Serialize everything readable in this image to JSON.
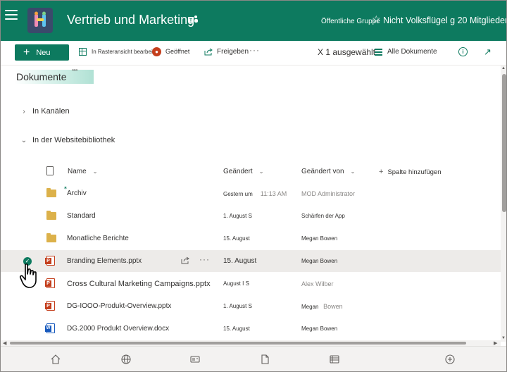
{
  "header": {
    "site_title": "Vertrieb und Marketing",
    "group_type": "Öffentliche Gruppe",
    "follow_text": "Nicht Volksflügel g 20 Mitglieder",
    "accent": "#0d7a5f"
  },
  "commandbar": {
    "new_label": "Neu",
    "grid_label": "In Rasteransicht bearbeiten",
    "open_label": "Geöffnet",
    "share_label": "Freigeben",
    "more_label": "···",
    "selected_label": "X 1 ausgewählt",
    "view_label": "Alle Dokumente",
    "info_glyph": "i",
    "expand_glyph": "↗"
  },
  "library": {
    "title": "Dokumente",
    "badge": "ooo"
  },
  "sections": {
    "channels": "In Kanälen",
    "site_library": "In der Websitebibliothek"
  },
  "columns": {
    "name": "Name",
    "modified": "Geändert",
    "modified_by": "Geändert von",
    "add_column": "Spalte hinzufügen"
  },
  "rows": [
    {
      "type": "folder",
      "name": "Archiv",
      "modified": "Gestern um",
      "modified_extra": "11:13 AM",
      "modified_by": "MOD Administrator",
      "by_faded": true
    },
    {
      "type": "folder",
      "name": "Standard",
      "modified": "1. August S",
      "modified_extra": "",
      "modified_by": "Schärfen der App",
      "by_faded": false
    },
    {
      "type": "folder",
      "name": "Monatliche Berichte",
      "modified": "15. August",
      "modified_extra": "",
      "modified_by": "Megan Bowen",
      "by_faded": false
    },
    {
      "type": "pptx",
      "name": "Branding Elements.pptx",
      "modified": "15. August",
      "modified_extra": "",
      "modified_by": "Megan Bowen",
      "by_faded": false,
      "selected": true
    },
    {
      "type": "pptx",
      "name": "Cross Cultural Marketing Campaigns.pptx",
      "modified": "August I S",
      "modified_extra": "",
      "modified_by": "Alex Wilber",
      "by_faded": true
    },
    {
      "type": "pptx",
      "name": "DG-IOOO-Produkt-Overview.pptx",
      "modified": "1. August S",
      "modified_extra": "",
      "modified_by": "Megan",
      "by_extra": "Bowen",
      "by_faded": false
    },
    {
      "type": "docx",
      "name": "DG.2000 Produkt Overview.docx",
      "modified": "15. August",
      "modified_extra": "",
      "modified_by": "Megan Bowen",
      "by_faded": false
    }
  ]
}
